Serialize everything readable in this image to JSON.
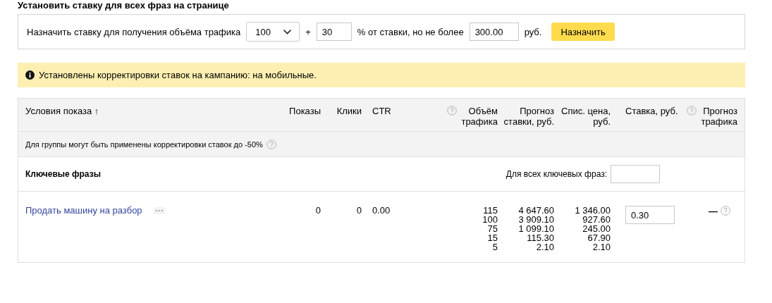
{
  "page_title": "Установить ставку для всех фраз на странице",
  "bid_form": {
    "label": "Назначить ставку для получения объёма трафика",
    "traffic_select": "100",
    "plus": "+",
    "percent_value": "30",
    "percent_label": "% от ставки, но не более",
    "max_value": "300.00",
    "currency": "руб.",
    "button": "Назначить"
  },
  "notice": "Установлены корректировки ставок на кампанию: на мобильные.",
  "table": {
    "columns": [
      {
        "label": "Условия показа ↑",
        "help": false
      },
      {
        "label": "Показы",
        "help": false
      },
      {
        "label": "Клики",
        "help": false
      },
      {
        "label": "CTR",
        "help": false
      },
      {
        "label": "Объём трафика",
        "help": true
      },
      {
        "label": "Прогноз ставки, руб.",
        "help": false
      },
      {
        "label": "Спис. цена, руб.",
        "help": false
      },
      {
        "label": "Ставка, руб.",
        "help": false
      },
      {
        "label": "Прогноз трафика",
        "help": true
      }
    ],
    "group_note": {
      "text": "Для группы могут быть применены корректировки ставок до -50%",
      "help": true
    },
    "section": {
      "title": "Ключевые фразы",
      "all_label": "Для всех ключевых фраз:"
    },
    "rows": [
      {
        "phrase": "Продать машину на разбор",
        "shows": "0",
        "clicks": "0",
        "ctr": "0.00",
        "bid": "0.30",
        "traffic_forecast": "—",
        "help": true,
        "levels": [
          {
            "volume": "115",
            "forecast": "4 647.60",
            "price": "1 346.00"
          },
          {
            "volume": "100",
            "forecast": "3 909.10",
            "price": "927.60"
          },
          {
            "volume": "75",
            "forecast": "1 099.10",
            "price": "245.00"
          },
          {
            "volume": "15",
            "forecast": "115.30",
            "price": "67.90"
          },
          {
            "volume": "5",
            "forecast": "2.10",
            "price": "2.10"
          }
        ]
      }
    ]
  }
}
